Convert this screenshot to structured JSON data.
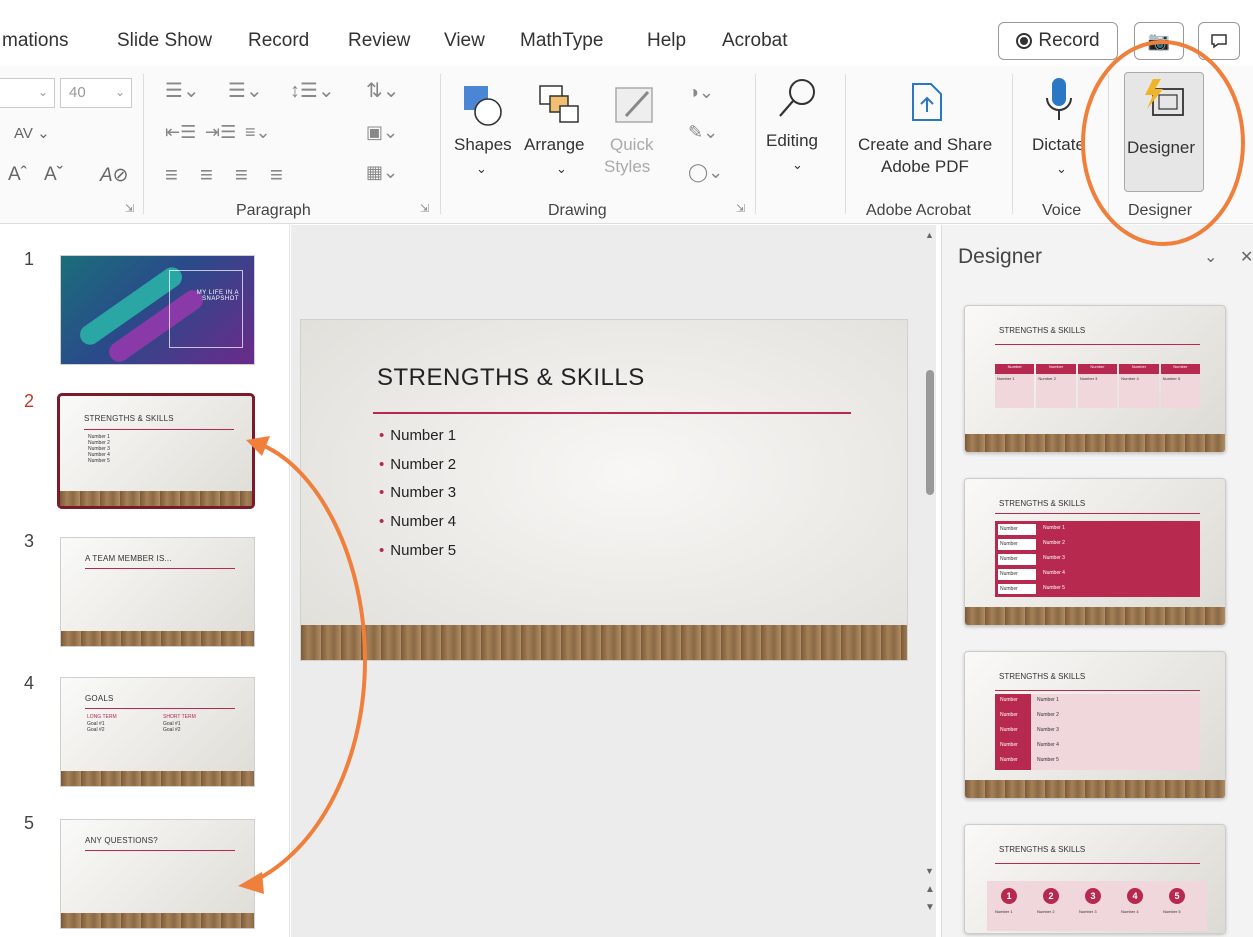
{
  "menu": {
    "items": [
      "mations",
      "Slide Show",
      "Record",
      "Review",
      "View",
      "MathType",
      "Help",
      "Acrobat"
    ],
    "record_button": "Record"
  },
  "ribbon": {
    "font_size": "40",
    "groups": {
      "paragraph": "Paragraph",
      "drawing": "Drawing",
      "adobe": "Adobe Acrobat",
      "voice": "Voice",
      "designer": "Designer"
    },
    "shapes": "Shapes",
    "arrange": "Arrange",
    "quick_styles": [
      "Quick",
      "Styles"
    ],
    "editing": "Editing",
    "adobe_pdf": [
      "Create and Share",
      "Adobe PDF"
    ],
    "dictate": "Dictate",
    "designer": "Designer"
  },
  "thumbnails": [
    {
      "num": "1",
      "title": "MY LIFE IN A SNAPSHOT"
    },
    {
      "num": "2",
      "title": "STRENGTHS & SKILLS",
      "bullets": [
        "Number 1",
        "Number 2",
        "Number 3",
        "Number 4",
        "Number 5"
      ]
    },
    {
      "num": "3",
      "title": "A TEAM MEMBER IS..."
    },
    {
      "num": "4",
      "title": "GOALS",
      "cols": [
        "LONG TERM",
        "SHORT TERM"
      ],
      "items": [
        "Goal #1",
        "Goal #2"
      ]
    },
    {
      "num": "5",
      "title": "ANY QUESTIONS?"
    }
  ],
  "slide": {
    "title": "STRENGTHS & SKILLS",
    "bullets": [
      "Number 1",
      "Number 2",
      "Number 3",
      "Number 4",
      "Number 5"
    ]
  },
  "designer": {
    "title": "Designer",
    "cards": [
      {
        "title": "STRENGTHS & SKILLS",
        "header": "Number",
        "cells": [
          "Number 1",
          "Number 2",
          "Number 3",
          "Number 4",
          "Number 5"
        ]
      },
      {
        "title": "STRENGTHS & SKILLS",
        "label": "Number",
        "rows": [
          "Number 1",
          "Number 2",
          "Number 3",
          "Number 4",
          "Number 5"
        ]
      },
      {
        "title": "STRENGTHS & SKILLS",
        "label": "Number",
        "rows": [
          "Number 1",
          "Number 2",
          "Number 3",
          "Number 4",
          "Number 5"
        ]
      },
      {
        "title": "STRENGTHS & SKILLS",
        "circles": [
          "1",
          "2",
          "3",
          "4",
          "5"
        ],
        "labels": [
          "Number 1",
          "Number 2",
          "Number 3",
          "Number 4",
          "Number 5"
        ]
      }
    ]
  },
  "colors": {
    "accent": "#b8294f",
    "annotation": "#f07f3c",
    "selected_border": "#7a1a2a"
  }
}
